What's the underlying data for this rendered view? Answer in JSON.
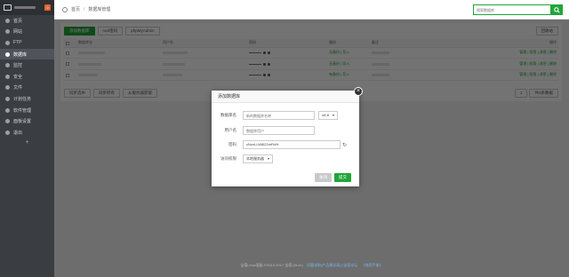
{
  "sidebar": {
    "badge": "0",
    "items": [
      {
        "label": "首页",
        "icon": "home-icon"
      },
      {
        "label": "网站",
        "icon": "globe-icon"
      },
      {
        "label": "FTP",
        "icon": "ftp-icon"
      },
      {
        "label": "数据库",
        "icon": "database-icon",
        "active": true
      },
      {
        "label": "监控",
        "icon": "monitor-icon"
      },
      {
        "label": "安全",
        "icon": "shield-icon"
      },
      {
        "label": "文件",
        "icon": "folder-icon"
      },
      {
        "label": "计划任务",
        "icon": "clock-icon"
      },
      {
        "label": "软件管理",
        "icon": "apps-icon"
      },
      {
        "label": "面板设置",
        "icon": "gear-icon"
      },
      {
        "label": "退出",
        "icon": "logout-icon"
      }
    ],
    "plus": "+"
  },
  "header": {
    "home": "首页",
    "sep": "/",
    "current": "数据库管理",
    "search_placeholder": "搜索数据库"
  },
  "toolbar": {
    "add": "添加数据库",
    "root_pw": "root密码",
    "phpmyadmin": "phpMyAdmin",
    "recycle": "回收站"
  },
  "table": {
    "headers": [
      "数据库名",
      "用户名",
      "密码",
      "备份",
      "备注",
      "操作"
    ],
    "rows": [
      {
        "backup_a": "无备份",
        "backup_b": "导入",
        "ops": "管理 | 权限 | 改密 | 删除"
      },
      {
        "backup_a": "无备份",
        "backup_b": "导入",
        "ops": "管理 | 权限 | 改密 | 删除"
      },
      {
        "backup_a": "有备份",
        "backup_b": "导入",
        "ops": "管理 | 权限 | 改密 | 删除"
      }
    ]
  },
  "bottom": {
    "sync_sel": "同步选中",
    "sync_all": "同步所有",
    "from_server": "从服务器获取",
    "page_num": "1",
    "page_total": "共3条数据"
  },
  "modal": {
    "title": "添加数据库",
    "name_label": "数据库名",
    "name_placeholder": "新的数据库名称",
    "charset": "utf-8",
    "user_label": "用户名",
    "user_placeholder": "数据库用户",
    "pw_label": "密码",
    "pw_value": "cNcnLLW8l22mFkfH",
    "access_label": "访问权限",
    "access_value": "本地服务器",
    "cancel": "关闭",
    "submit": "提交"
  },
  "footer": {
    "copyright": "宝塔Linux面板 ©2014-2017 宝塔 (bt.cn)",
    "forum": "问题求助|产品建议请上宝塔论坛",
    "manual": "《使用手册》"
  },
  "colors": {
    "accent": "#20a53a",
    "sidebar": "#3a3d42",
    "badge": "#e0642c"
  }
}
